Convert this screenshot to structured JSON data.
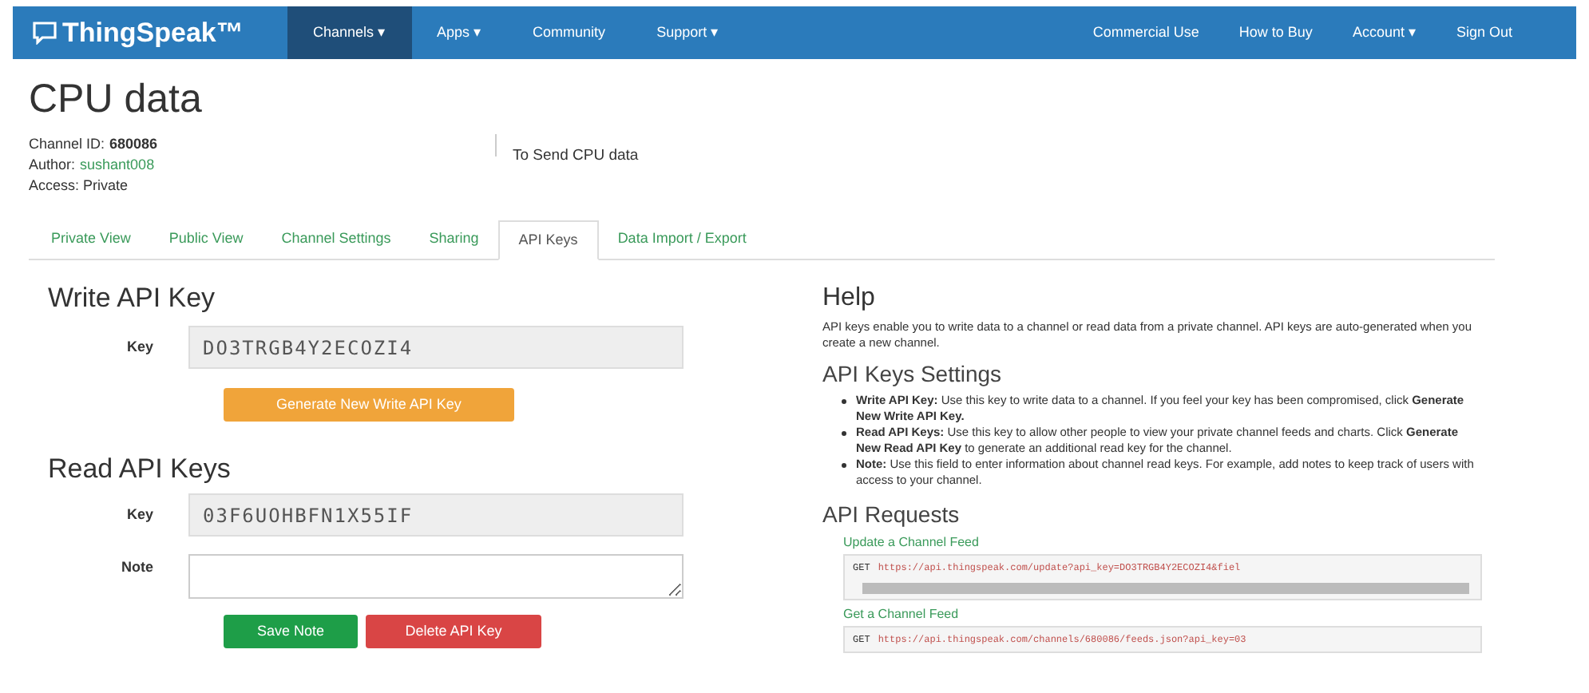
{
  "brand": "ThingSpeak™",
  "nav_left": [
    {
      "label": "Channels ▾",
      "selected": true
    },
    {
      "label": "Apps ▾",
      "selected": false
    },
    {
      "label": "Community",
      "selected": false
    },
    {
      "label": "Support ▾",
      "selected": false
    }
  ],
  "nav_right": [
    {
      "label": "Commercial Use"
    },
    {
      "label": "How to Buy"
    },
    {
      "label": "Account ▾"
    },
    {
      "label": "Sign Out"
    }
  ],
  "title": "CPU data",
  "meta": {
    "channel_id_label": "Channel ID:",
    "channel_id": "680086",
    "author_label": "Author:",
    "author": "sushant008",
    "access": "Access: Private",
    "description": "To Send CPU data"
  },
  "tabs": [
    {
      "label": "Private View",
      "selected": false
    },
    {
      "label": "Public View",
      "selected": false
    },
    {
      "label": "Channel Settings",
      "selected": false
    },
    {
      "label": "Sharing",
      "selected": false
    },
    {
      "label": "API Keys",
      "selected": true
    },
    {
      "label": "Data Import / Export",
      "selected": false
    }
  ],
  "write": {
    "heading": "Write API Key",
    "key_label": "Key",
    "key": "DO3TRGB4Y2ECOZI4",
    "button": "Generate New Write API Key"
  },
  "read": {
    "heading": "Read API Keys",
    "key_label": "Key",
    "key": "03F6UOHBFN1X55IF",
    "note_label": "Note",
    "save": "Save Note",
    "delete": "Delete API Key"
  },
  "help": {
    "heading": "Help",
    "text": "API keys enable you to write data to a channel or read data from a private channel. API keys are auto-generated when you create a new channel.",
    "settings_heading": "API Keys Settings",
    "bullets": [
      "**Write API Key:** Use this key to write data to a channel. If you feel your key has been compromised, click **Generate New Write API Key.**",
      "**Read API Keys:** Use this key to allow other people to view your private channel feeds and charts. Click **Generate New Read API Key** to generate an additional read key for the channel.",
      "**Note:** Use this field to enter information about channel read keys. For example, add notes to keep track of users with access to your channel."
    ],
    "requests_heading": "API Requests",
    "requests": [
      {
        "title": "Update a Channel Feed",
        "method": "GET",
        "url": "https://api.thingspeak.com/update?api_key=DO3TRGB4Y2ECOZI4&fiel",
        "scrollbar": true
      },
      {
        "title": "Get a Channel Feed",
        "method": "GET",
        "url": "https://api.thingspeak.com/channels/680086/feeds.json?api_key=03",
        "scrollbar": false
      }
    ]
  }
}
